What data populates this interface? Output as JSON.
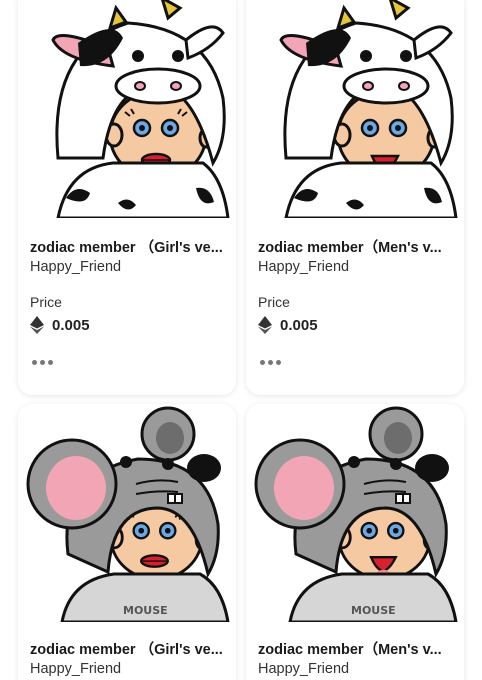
{
  "cards": [
    {
      "name": "zodiac member （Girl's ve...",
      "creator": "Happy_Friend",
      "price_label": "Price",
      "price": "0.005",
      "costume": "cow",
      "expression": "girl"
    },
    {
      "name": "zodiac member（Men's v...",
      "creator": "Happy_Friend",
      "price_label": "Price",
      "price": "0.005",
      "costume": "cow",
      "expression": "boy"
    },
    {
      "name": "zodiac member （Girl's ve...",
      "creator": "Happy_Friend",
      "costume": "mouse",
      "expression": "girl"
    },
    {
      "name": "zodiac member（Men's v...",
      "creator": "Happy_Friend",
      "costume": "mouse",
      "expression": "boy"
    }
  ],
  "icons": {
    "currency": "ethereum-icon",
    "menu": "more-dots-icon"
  },
  "colors": {
    "card_bg": "#ffffff",
    "text": "#1b1b1b",
    "cow_horn": "#e5c53a",
    "ear_pink": "#f2a5b5",
    "mouse_gray": "#9a9a9a"
  }
}
